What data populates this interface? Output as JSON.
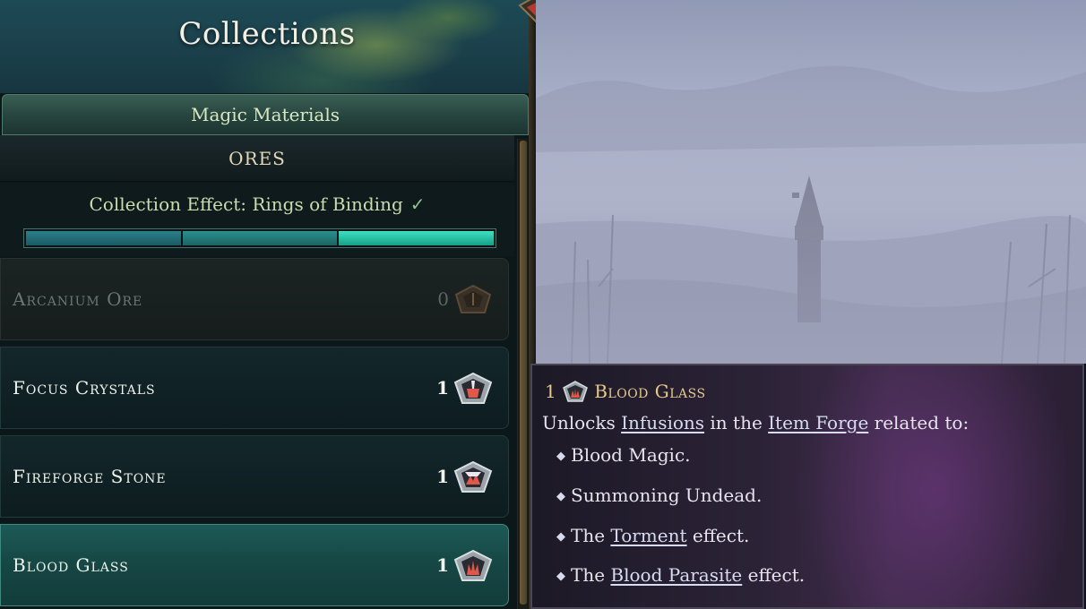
{
  "header": {
    "title": "Collections"
  },
  "tabs": {
    "active_label": "Magic Materials"
  },
  "section": {
    "title": "ORES"
  },
  "collection_effect": {
    "label": "Collection Effect: Rings of Binding",
    "check": "✓",
    "progress_segments_filled": 3,
    "progress_segments_total": 3
  },
  "items": [
    {
      "label": "Arcanium Ore",
      "count": "0",
      "state": "locked",
      "icon": "arcanium-ore-icon"
    },
    {
      "label": "Focus Crystals",
      "count": "1",
      "state": "owned",
      "icon": "focus-crystals-icon"
    },
    {
      "label": "Fireforge Stone",
      "count": "1",
      "state": "owned",
      "icon": "fireforge-stone-icon"
    },
    {
      "label": "Blood Glass",
      "count": "1",
      "state": "selected",
      "icon": "blood-glass-icon"
    }
  ],
  "tooltip": {
    "count": "1",
    "title": "Blood Glass",
    "line_prefix": "Unlocks",
    "link_infusions": "Infusions",
    "line_mid": "in the",
    "link_item_forge": "Item Forge",
    "line_suffix": "related to:",
    "bullet_1": "Blood Magic.",
    "bullet_2": "Summoning Undead.",
    "bullet_3_prefix": "The",
    "bullet_3_link": "Torment",
    "bullet_3_suffix": "effect.",
    "bullet_4_prefix": "The",
    "bullet_4_link": "Blood Parasite",
    "bullet_4_suffix": "effect."
  },
  "colors": {
    "accent_teal": "#3de0c0",
    "gold_text": "#e6c98c",
    "selected_row": "#1d5a57"
  }
}
